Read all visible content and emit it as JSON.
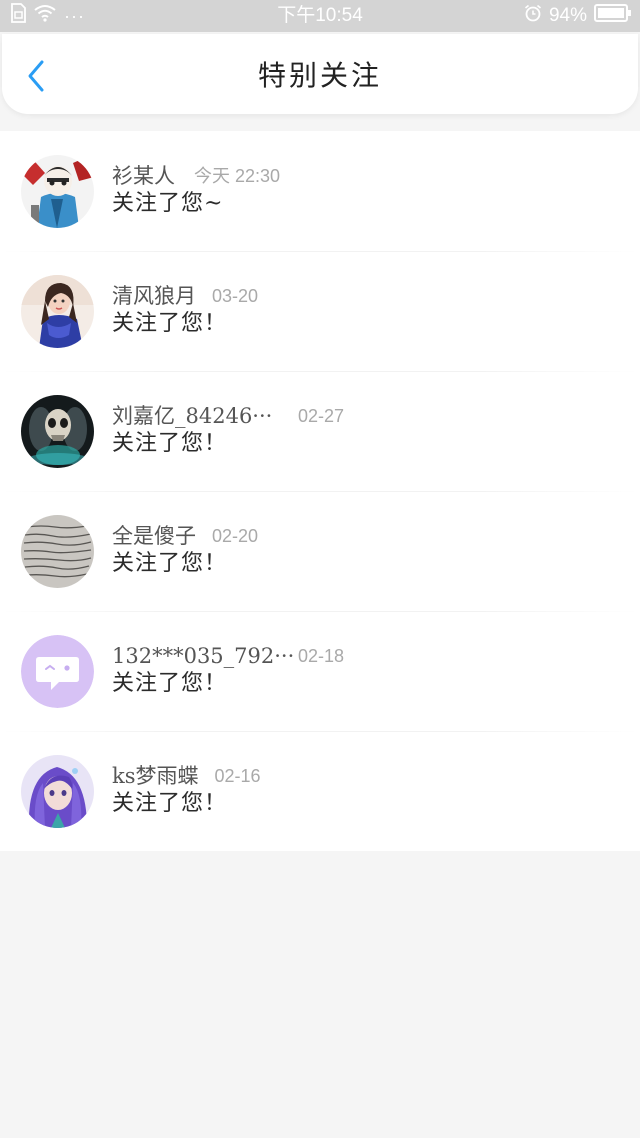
{
  "status_bar": {
    "time": "下午10:54",
    "battery": "94%",
    "dots": "···"
  },
  "header": {
    "title": "特别关注"
  },
  "items": [
    {
      "name": "衫某人",
      "time": "今天 22:30",
      "action": "关注了您~",
      "avatar_icon": "anime-character-avatar"
    },
    {
      "name": "清风狼月",
      "time": "03-20",
      "action": "关注了您！",
      "avatar_icon": "woman-blue-dress-avatar"
    },
    {
      "name": "刘嘉亿_84246···",
      "time": "02-27",
      "action": "关注了您！",
      "avatar_icon": "skull-warrior-avatar"
    },
    {
      "name": "全是傻子",
      "time": "02-20",
      "action": "关注了您！",
      "avatar_icon": "handwritten-paper-avatar"
    },
    {
      "name": "132***035_792···",
      "time": "02-18",
      "action": "关注了您！",
      "avatar_icon": "default-chat-avatar"
    },
    {
      "name": "ks梦雨蝶",
      "time": "02-16",
      "action": "关注了您！",
      "avatar_icon": "purple-hair-girl-avatar"
    }
  ],
  "colors": {
    "accent": "#2a9df4",
    "default_avatar": "#d7c2f5"
  }
}
